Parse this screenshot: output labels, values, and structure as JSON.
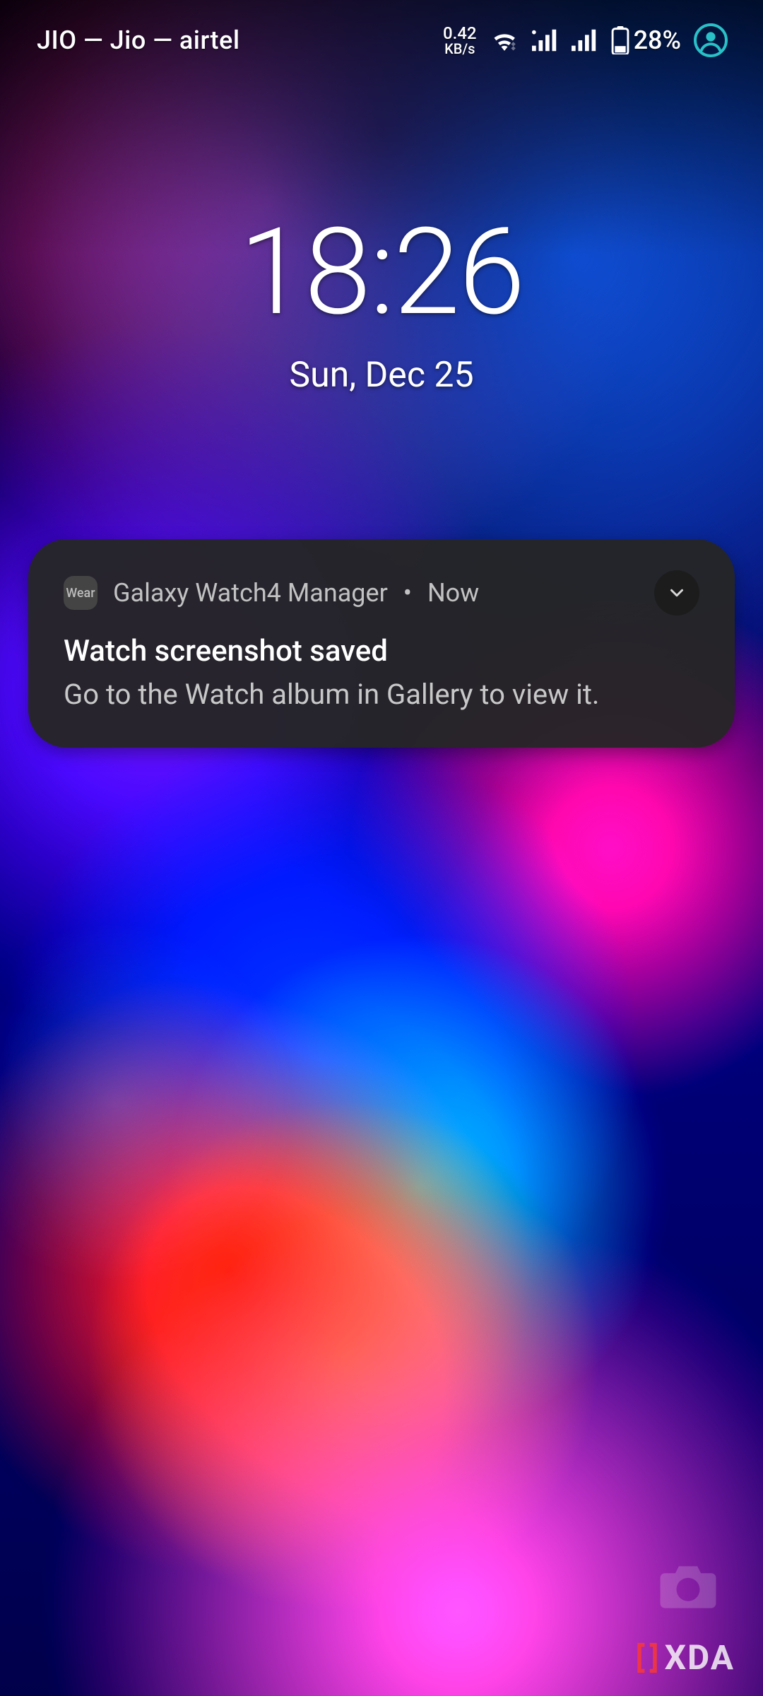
{
  "statusbar": {
    "carriers_text": "JIO — Jio — airtel",
    "data_rate_value": "0.42",
    "data_rate_unit": "KB/s",
    "battery_percent": "28%",
    "accent_color": "#29c1c7"
  },
  "clock": {
    "time": "18:26",
    "date": "Sun, Dec 25"
  },
  "notification": {
    "app_icon_label": "Wear",
    "app_name": "Galaxy Watch4 Manager",
    "separator": "•",
    "time": "Now",
    "title": "Watch screenshot saved",
    "body": "Go to the Watch album in Gallery to view it."
  },
  "watermark": {
    "brand": "XDA"
  }
}
